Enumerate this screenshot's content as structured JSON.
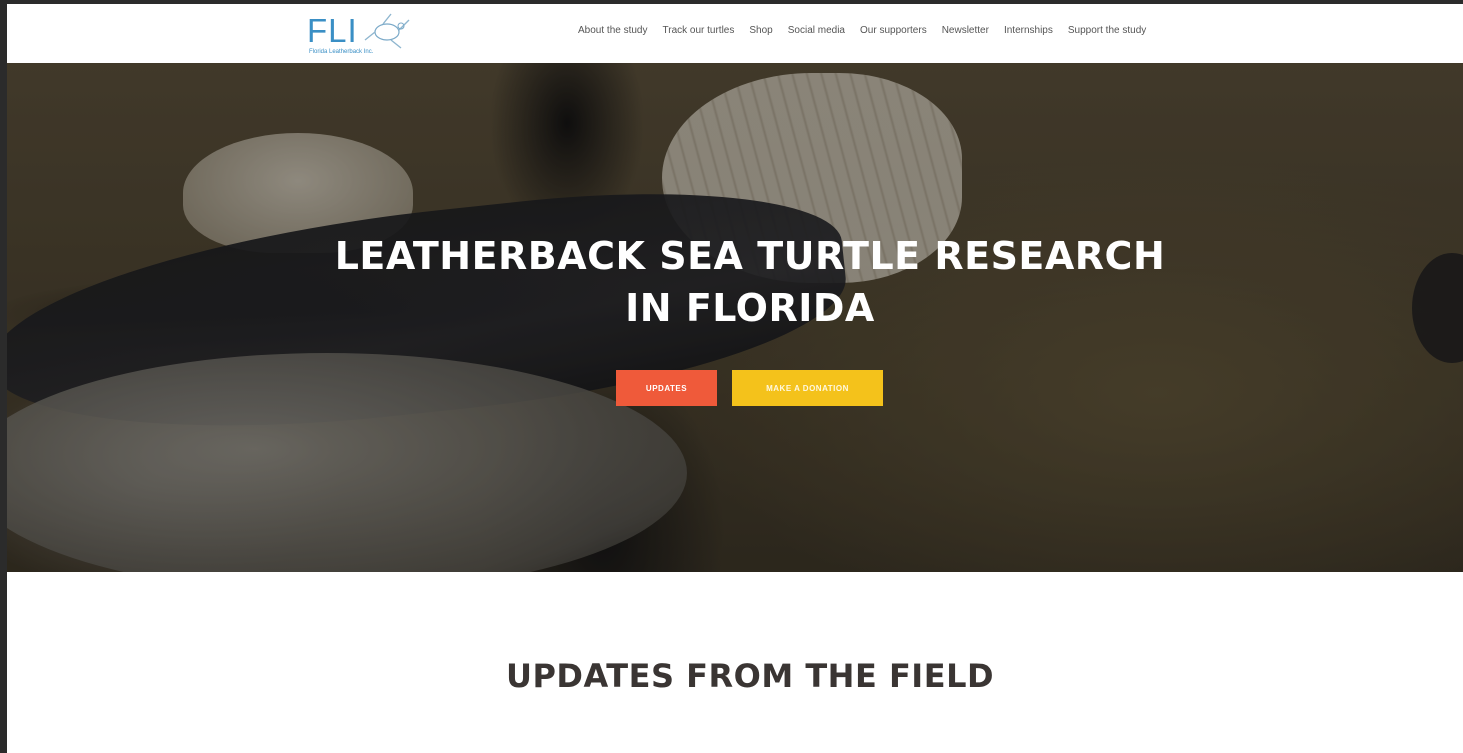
{
  "header": {
    "logo_text": "FLI",
    "logo_subtext": "Florida Leatherback Inc.",
    "nav": [
      {
        "label": "About the study"
      },
      {
        "label": "Track our turtles"
      },
      {
        "label": "Shop"
      },
      {
        "label": "Social media"
      },
      {
        "label": "Our supporters"
      },
      {
        "label": "Newsletter"
      },
      {
        "label": "Internships"
      },
      {
        "label": "Support the study"
      }
    ]
  },
  "hero": {
    "title_line1": "LEATHERBACK SEA TURTLE RESEARCH",
    "title_line2": "IN FLORIDA",
    "buttons": {
      "updates": "UPDATES",
      "donate": "MAKE A DONATION"
    }
  },
  "section": {
    "title": "UPDATES FROM THE FIELD"
  },
  "colors": {
    "logo_blue": "#3a8fc5",
    "updates_button": "#ef5a3a",
    "donate_button": "#f4c21b",
    "page_frame": "#2b2b2b"
  }
}
